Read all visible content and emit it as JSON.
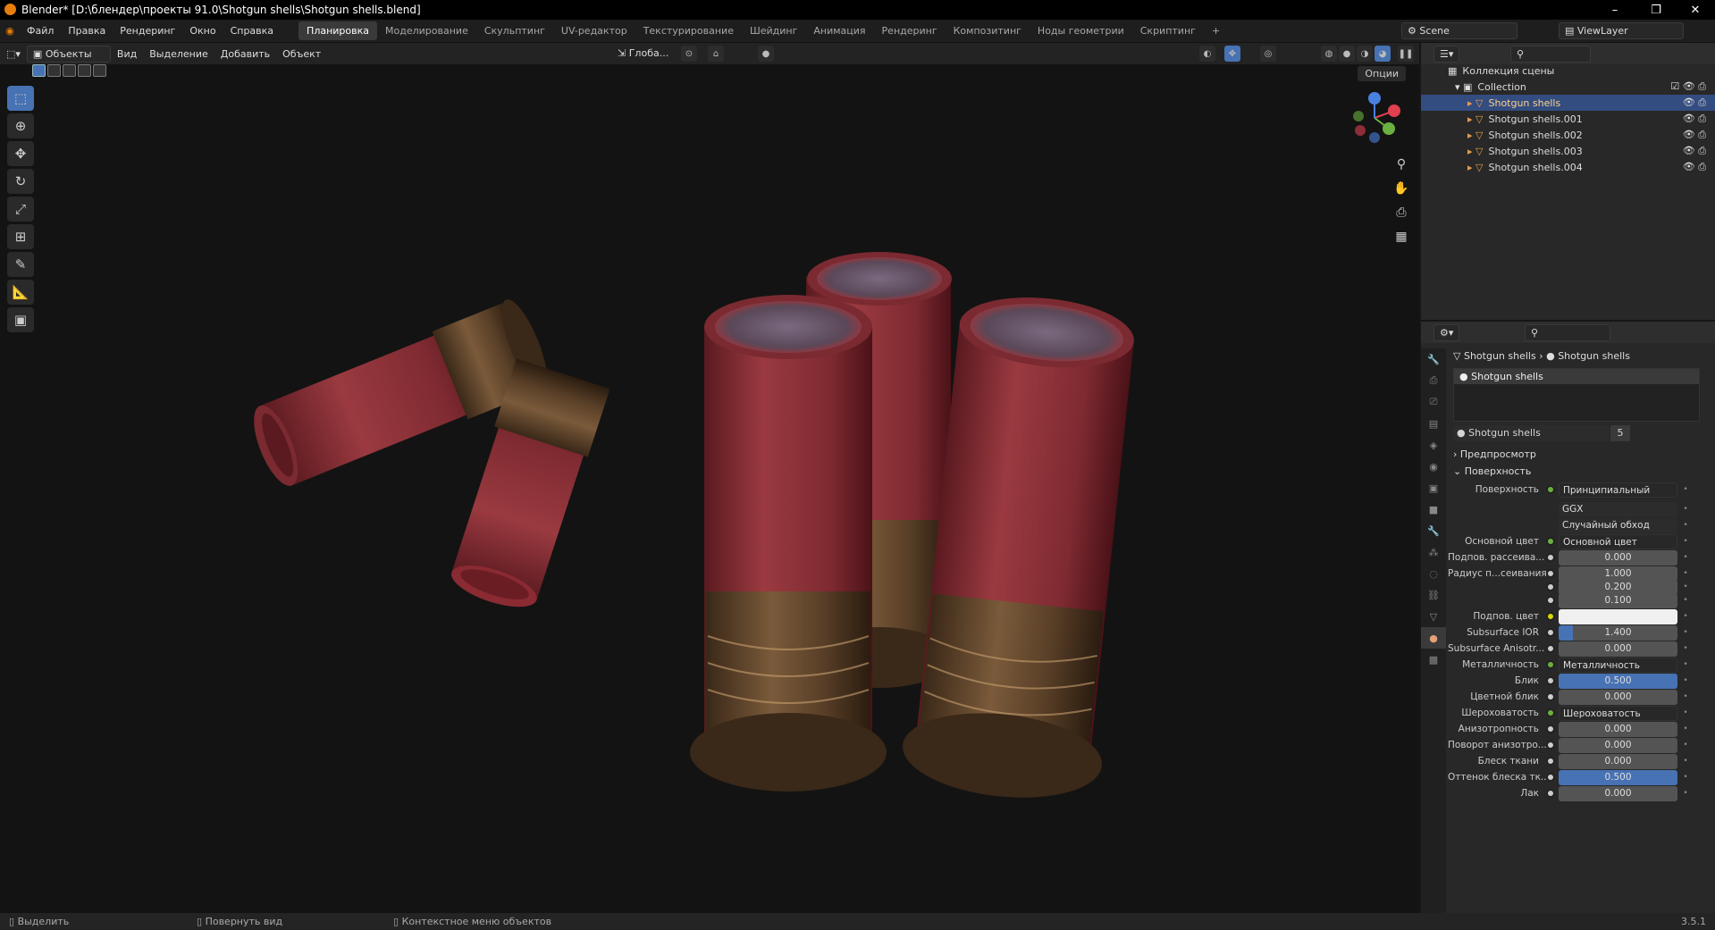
{
  "window": {
    "title": "Blender* [D:\\блендер\\проекты 91.0\\Shotgun shells\\Shotgun shells.blend]",
    "minimize": "–",
    "maximize": "❐",
    "close": "✕"
  },
  "menu": [
    "Файл",
    "Правка",
    "Рендеринг",
    "Окно",
    "Справка"
  ],
  "workspaces": [
    "Планировка",
    "Моделирование",
    "Скульптинг",
    "UV-редактор",
    "Текстурирование",
    "Шейдинг",
    "Анимация",
    "Рендеринг",
    "Композитинг",
    "Ноды геометрии",
    "Скриптинг",
    "+"
  ],
  "active_workspace": "Планировка",
  "scene": {
    "label": "Scene",
    "viewlayer": "ViewLayer"
  },
  "header3d": {
    "mode": "Объекты",
    "view": "Вид",
    "select": "Выделение",
    "add": "Добавить",
    "object": "Объект",
    "transform": "Глоба...",
    "options": "Опции"
  },
  "outliner": {
    "scene_collection": "Коллекция сцены",
    "collection": "Collection",
    "items": [
      "Shotgun shells",
      "Shotgun shells.001",
      "Shotgun shells.002",
      "Shotgun shells.003",
      "Shotgun shells.004"
    ],
    "selected": "Shotgun shells"
  },
  "properties": {
    "breadcrumb_obj": "Shotgun shells",
    "breadcrumb_mat": "Shotgun shells",
    "slot": "Shotgun shells",
    "material_name": "Shotgun shells",
    "users": "5",
    "panel_preview": "Предпросмотр",
    "panel_surface": "Поверхность",
    "rows": [
      {
        "label": "Поверхность",
        "value": "Принципиальный BSDF",
        "kind": "sock"
      },
      {
        "label": "",
        "value": "GGX",
        "kind": "dd"
      },
      {
        "label": "",
        "value": "Случайный обход",
        "kind": "dd"
      },
      {
        "label": "Основной цвет",
        "value": "Основной цвет",
        "kind": "sock"
      },
      {
        "label": "Подпов. рассеива...",
        "value": "0.000",
        "kind": "num"
      },
      {
        "label": "Радиус п...сеивания",
        "value": "1.000",
        "kind": "num"
      },
      {
        "label": "",
        "value": "0.200",
        "kind": "num"
      },
      {
        "label": "",
        "value": "0.100",
        "kind": "num"
      },
      {
        "label": "Подпов. цвет",
        "value": "",
        "kind": "color"
      },
      {
        "label": "Subsurface IOR",
        "value": "1.400",
        "kind": "num"
      },
      {
        "label": "Subsurface Anisotr...",
        "value": "0.000",
        "kind": "num"
      },
      {
        "label": "Металличность",
        "value": "Металличность",
        "kind": "sock"
      },
      {
        "label": "Блик",
        "value": "0.500",
        "kind": "blue"
      },
      {
        "label": "Цветной блик",
        "value": "0.000",
        "kind": "num"
      },
      {
        "label": "Шероховатость",
        "value": "Шероховатость",
        "kind": "sock"
      },
      {
        "label": "Анизотропность",
        "value": "0.000",
        "kind": "num"
      },
      {
        "label": "Поворот анизотро...",
        "value": "0.000",
        "kind": "num"
      },
      {
        "label": "Блеск ткани",
        "value": "0.000",
        "kind": "num"
      },
      {
        "label": "Оттенок блеска тк...",
        "value": "0.500",
        "kind": "blue"
      },
      {
        "label": "Лак",
        "value": "0.000",
        "kind": "num"
      }
    ]
  },
  "status": {
    "select": "Выделить",
    "rotate": "Повернуть вид",
    "context": "Контекстное меню объектов",
    "version": "3.5.1"
  },
  "colors": {
    "accent": "#4772b3",
    "shell_red": "#8a2f35",
    "brass": "#6a4a2a"
  }
}
